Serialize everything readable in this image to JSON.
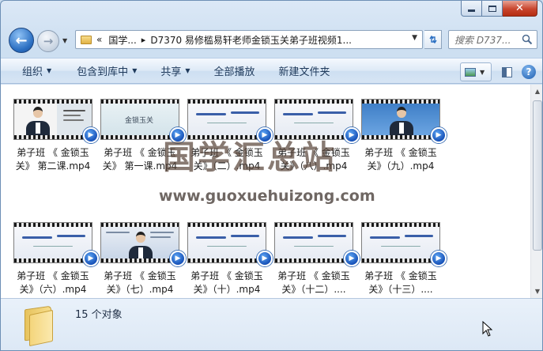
{
  "window": {
    "caption": {
      "minimize": "",
      "maximize": "",
      "close": "✕"
    }
  },
  "nav": {
    "back_glyph": "←",
    "forward_glyph": "→",
    "address": {
      "prefix": "«",
      "segment1": "国学...",
      "separator": "▸",
      "segment2": "D7370 易修槛易轩老师金锁玉关弟子班视频1..."
    },
    "search_placeholder": "搜索 D737..."
  },
  "commandbar": {
    "organize": "组织",
    "include_in_library": "包含到库中",
    "share": "共享",
    "play_all": "全部播放",
    "new_folder": "新建文件夹",
    "help": "?"
  },
  "files": [
    {
      "name": "弟子班 《 金锁玉关》 第二课.mp4",
      "thumb": "intro"
    },
    {
      "name": "弟子班 《 金锁玉关》 第一课.mp4",
      "thumb": "title",
      "thumb_text": "金锁玉关"
    },
    {
      "name": "弟子班 《 金锁玉关》（二）.mp4",
      "thumb": "ink"
    },
    {
      "name": "弟子班 《 金锁玉关》（八）.mp4",
      "thumb": "ink"
    },
    {
      "name": "弟子班 《 金锁玉关》（九）.mp4",
      "thumb": "person"
    },
    {
      "name": "弟子班 《 金锁玉关》（六）.mp4",
      "thumb": "ink"
    },
    {
      "name": "弟子班 《 金锁玉关》（七）.mp4",
      "thumb": "doc"
    },
    {
      "name": "弟子班 《 金锁玉关》（十）.mp4",
      "thumb": "ink"
    },
    {
      "name": "弟子班 《 金锁玉关》（十二）....",
      "thumb": "ink"
    },
    {
      "name": "弟子班 《 金锁玉关》（十三）....",
      "thumb": "ink"
    }
  ],
  "watermark": {
    "title": "国学汇总站",
    "url": "www.guoxuehuizong.com"
  },
  "details": {
    "count": "15 个对象"
  },
  "colors": {
    "accent": "#2b6fc2",
    "close_red": "#c8452d",
    "badge_blue": "#1852b8"
  }
}
